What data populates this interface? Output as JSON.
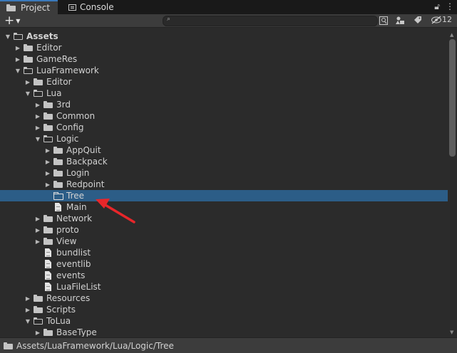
{
  "tabs": [
    {
      "label": "Project",
      "icon": "folder-icon",
      "active": true
    },
    {
      "label": "Console",
      "icon": "console-icon",
      "active": false
    }
  ],
  "toolbar": {
    "add_label": "+",
    "search_value": "",
    "hidden_count": "12"
  },
  "tree": [
    {
      "label": "Assets",
      "indent": 0,
      "expander": "open",
      "icon": "folder-open",
      "bold": true
    },
    {
      "label": "Editor",
      "indent": 1,
      "expander": "closed",
      "icon": "folder"
    },
    {
      "label": "GameRes",
      "indent": 1,
      "expander": "closed",
      "icon": "folder"
    },
    {
      "label": "LuaFramework",
      "indent": 1,
      "expander": "open",
      "icon": "folder-open"
    },
    {
      "label": "Editor",
      "indent": 2,
      "expander": "closed",
      "icon": "folder"
    },
    {
      "label": "Lua",
      "indent": 2,
      "expander": "open",
      "icon": "folder-open"
    },
    {
      "label": "3rd",
      "indent": 3,
      "expander": "closed",
      "icon": "folder"
    },
    {
      "label": "Common",
      "indent": 3,
      "expander": "closed",
      "icon": "folder"
    },
    {
      "label": "Config",
      "indent": 3,
      "expander": "closed",
      "icon": "folder"
    },
    {
      "label": "Logic",
      "indent": 3,
      "expander": "open",
      "icon": "folder-open"
    },
    {
      "label": "AppQuit",
      "indent": 4,
      "expander": "closed",
      "icon": "folder"
    },
    {
      "label": "Backpack",
      "indent": 4,
      "expander": "closed",
      "icon": "folder"
    },
    {
      "label": "Login",
      "indent": 4,
      "expander": "closed",
      "icon": "folder"
    },
    {
      "label": "Redpoint",
      "indent": 4,
      "expander": "closed",
      "icon": "folder"
    },
    {
      "label": "Tree",
      "indent": 4,
      "expander": "none",
      "icon": "folder-empty",
      "selected": true
    },
    {
      "label": "Main",
      "indent": 4,
      "expander": "none",
      "icon": "file"
    },
    {
      "label": "Network",
      "indent": 3,
      "expander": "closed",
      "icon": "folder"
    },
    {
      "label": "proto",
      "indent": 3,
      "expander": "closed",
      "icon": "folder"
    },
    {
      "label": "View",
      "indent": 3,
      "expander": "closed",
      "icon": "folder"
    },
    {
      "label": "bundlist",
      "indent": 3,
      "expander": "none",
      "icon": "file"
    },
    {
      "label": "eventlib",
      "indent": 3,
      "expander": "none",
      "icon": "file"
    },
    {
      "label": "events",
      "indent": 3,
      "expander": "none",
      "icon": "file"
    },
    {
      "label": "LuaFileList",
      "indent": 3,
      "expander": "none",
      "icon": "file"
    },
    {
      "label": "Resources",
      "indent": 2,
      "expander": "closed",
      "icon": "folder"
    },
    {
      "label": "Scripts",
      "indent": 2,
      "expander": "closed",
      "icon": "folder"
    },
    {
      "label": "ToLua",
      "indent": 2,
      "expander": "open",
      "icon": "folder-open"
    },
    {
      "label": "BaseType",
      "indent": 3,
      "expander": "closed",
      "icon": "folder"
    }
  ],
  "path": "Assets/LuaFramework/Lua/Logic/Tree",
  "colors": {
    "selection": "#2c5d87",
    "annotation_arrow": "#e8262a"
  }
}
